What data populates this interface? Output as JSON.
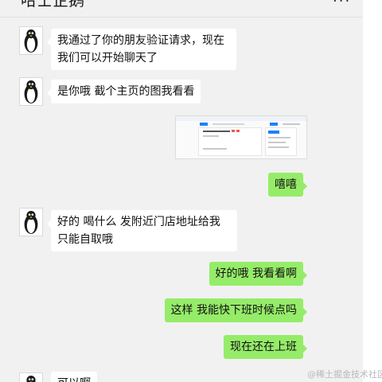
{
  "header": {
    "title": "哈士企鹅",
    "more_icon": "more-dots-icon",
    "more_label": "···"
  },
  "messages": [
    {
      "side": "in",
      "type": "text",
      "text": "我通过了你的朋友验证请求，现在我们可以开始聊天了"
    },
    {
      "side": "in",
      "type": "text",
      "text": " 是你哦  截个主页的图我看看"
    },
    {
      "side": "out",
      "type": "image",
      "content": "screenshot-thumbnail"
    },
    {
      "side": "out",
      "type": "text",
      "text": "嘻嘻"
    },
    {
      "side": "in",
      "type": "text",
      "text": " 好的  喝什么  发附近门店地址给我只能自取哦"
    },
    {
      "side": "out",
      "type": "text",
      "text": "好的哦  我看看啊"
    },
    {
      "side": "out",
      "type": "text",
      "text": "这样 我能快下班时候点吗"
    },
    {
      "side": "out",
      "type": "text",
      "text": "现在还在上班"
    },
    {
      "side": "in",
      "type": "text",
      "text": " 可以啊"
    }
  ],
  "avatar": {
    "icon": "penguin-avatar-icon"
  },
  "watermark": "@稀土掘金技术社区",
  "colors": {
    "background": "#f1f1f1",
    "incoming_bubble": "#ffffff",
    "outgoing_bubble": "#95ec69",
    "panel_right": "#ffffff"
  }
}
